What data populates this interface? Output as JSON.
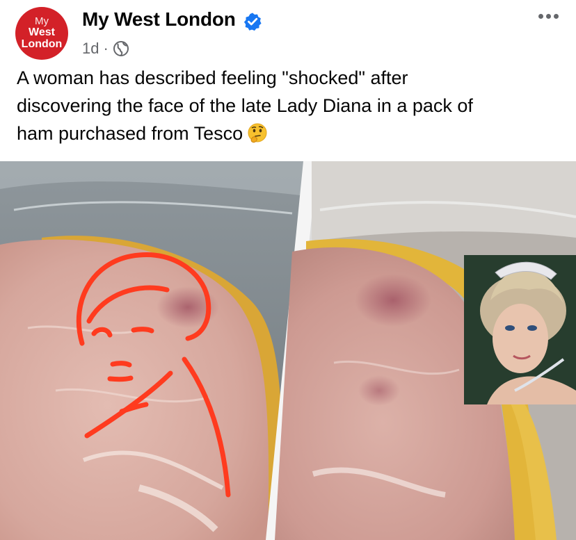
{
  "post": {
    "avatar": {
      "line1": "My",
      "line2": "West",
      "line3": "London"
    },
    "page_name": "My West London",
    "verified_icon": "verified-badge-icon",
    "timestamp": "1d",
    "separator": "·",
    "audience_icon": "globe-icon",
    "more_icon": "more-options-icon",
    "caption_line1": "A woman has described feeling \"shocked\" after",
    "caption_line2": "discovering the face of the late Lady Diana in a pack of",
    "caption_line3": "ham purchased from Tesco",
    "caption_emoji": "thinking-face-emoji",
    "image": "ham-slice-photo-collage",
    "colors": {
      "brand": "#d32128",
      "verified": "#1877f2",
      "meta_gray": "#65676b",
      "drawing_red": "#ff3b1f"
    }
  }
}
